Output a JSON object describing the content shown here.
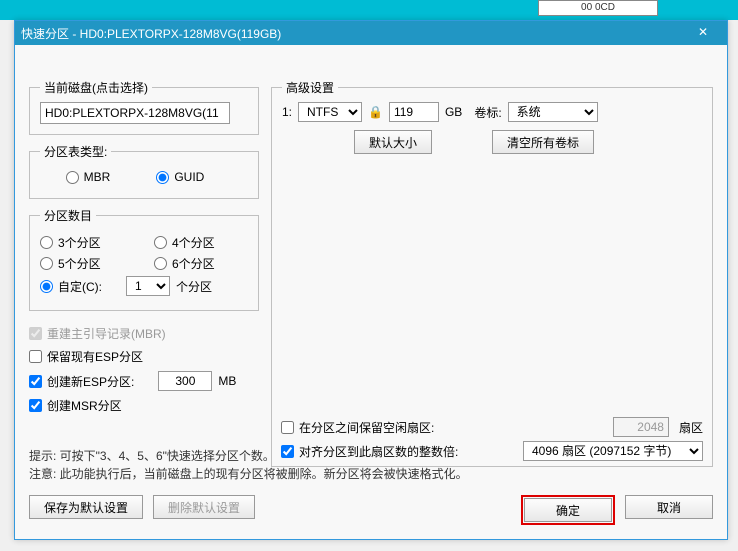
{
  "bg_label": "00 0CD",
  "title": "快速分区 - HD0:PLEXTORPX-128M8VG(119GB)",
  "close_x": "✕",
  "currentDisk": {
    "legend": "当前磁盘(点击选择)",
    "value": "HD0:PLEXTORPX-128M8VG(11"
  },
  "tableType": {
    "legend": "分区表类型:",
    "mbr": "MBR",
    "guid": "GUID"
  },
  "partCount": {
    "legend": "分区数目",
    "p3": "3个分区",
    "p4": "4个分区",
    "p5": "5个分区",
    "p6": "6个分区",
    "custom": "自定(C):",
    "customVal": "1",
    "customUnit": "个分区"
  },
  "checks": {
    "rebuildMBR": "重建主引导记录(MBR)",
    "keepESP": "保留现有ESP分区",
    "newESP": "创建新ESP分区:",
    "newESPval": "300",
    "mb": "MB",
    "msr": "创建MSR分区"
  },
  "adv": {
    "legend": "高级设置",
    "idx1": "1:",
    "fs": "NTFS",
    "lock": "🔒",
    "size": "119",
    "gb": "GB",
    "labelLbl": "卷标:",
    "labelVal": "系统",
    "defaultSize": "默认大小",
    "clearLabels": "清空所有卷标"
  },
  "bottom": {
    "gap": "在分区之间保留空闲扇区:",
    "gapVal": "2048",
    "sector": "扇区",
    "align": "对齐分区到此扇区数的整数倍:",
    "alignVal": "4096 扇区 (2097152 字节)"
  },
  "hint": {
    "l1": "提示: 可按下\"3、4、5、6\"快速选择分区个数。",
    "l2": "注意: 此功能执行后，当前磁盘上的现有分区将被删除。新分区将会被快速格式化。"
  },
  "buttons": {
    "saveDefault": "保存为默认设置",
    "delDefault": "删除默认设置",
    "ok": "确定",
    "cancel": "取消"
  }
}
